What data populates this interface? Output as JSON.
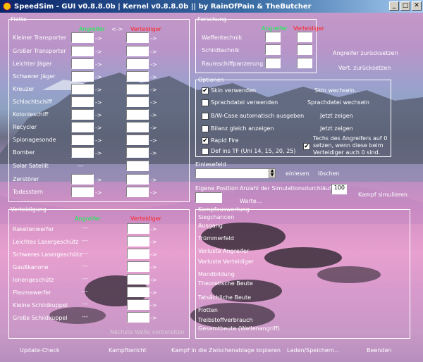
{
  "window": {
    "title": "SpeedSim - GUI v0.8.8.0b | Kernel v0.8.8.0b  ||  by RainOfPain & TheButcher",
    "minimize": "_",
    "maximize": "□",
    "close": "✕"
  },
  "fleet": {
    "title": "Flotte",
    "swap": "<->",
    "attacker_header": "Angreifer",
    "defender_header": "Verteidiger",
    "ships": [
      "Kleiner Transporter",
      "Großer Transporter",
      "Leichter Jäger",
      "Schwerer Jäger",
      "Kreuzer",
      "Schlachtschiff",
      "Kolonieschiff",
      "Recycler",
      "Spionagesonde",
      "Bomber",
      "Solar Satellit",
      "Zerstörer",
      "Todesstern"
    ],
    "arrow": "->",
    "solar_dash": "---"
  },
  "research": {
    "title": "Forschung",
    "attacker_header": "Angreifer",
    "defender_header": "Verteidiger",
    "rows": [
      "Waffentechnik",
      "Schildtechnik",
      "Raumschiffpanzerung"
    ],
    "reset_attacker": "Angreifer zurücksetzen",
    "reset_defender": "Vert. zurücksetzen"
  },
  "options": {
    "title": "Optionen",
    "skin_use": "Skin verwenden",
    "skin_use_checked": "✔",
    "lang_use": "Sprachdatei verwenden",
    "bbcode": "B/W-Case automatisch ausgeben",
    "bilanz": "Bilanz gleich anzeigen",
    "rapid_fire": "Rapid Fire",
    "rapid_fire_checked": "✔",
    "def_tf": "Def ins TF (Uni 14, 15, 20, 25)",
    "skin_change": "Skin wechseln...",
    "lang_change": "Sprachdatei wechseln",
    "show_now_1": "Jetzt zeigen",
    "show_now_2": "Jetzt zeigen",
    "techs_checked": "✔",
    "techs_text_1": "Techs des Angreifers auf 0",
    "techs_text_2": "setzen, wenn diese beim",
    "techs_text_3": "Verteidiger auch 0 sind."
  },
  "readin": {
    "title": "Einlesefeld",
    "read": "einlesen",
    "clear": "löschen"
  },
  "position": {
    "title": "Eigene Position",
    "wait": "Warte..."
  },
  "simulation": {
    "count_label": "Anzahl der Simulationsdurchläufe",
    "count_value": "100",
    "run": "Kampf simulieren"
  },
  "defense": {
    "title": "Verteidigung",
    "attacker_header": "Angreifer",
    "defender_header": "Verteidiger",
    "items": [
      "Raketenwerfer",
      "Leichtes Lasergeschütz",
      "Schweres Lasergeschütz",
      "Gaußkanone",
      "Ionengeschütz",
      "Plasmawerfer",
      "Kleine Schildkuppel",
      "Große Schildkuppel"
    ],
    "dash": "---",
    "next_wave": "Nächste Welle vorbereiten"
  },
  "results": {
    "title": "Kampfauswertung",
    "rows": [
      "Siegchancen",
      "Ausgang",
      "Trümmerfeld",
      "Verluste Angreifer",
      "Verluste Verteidiger",
      "Mondbildung",
      "Theoretische Beute",
      "Tatsächliche Beute",
      "Flotten",
      "Treibstoffverbrauch",
      "Gesamtbeute (Wellenangriff)"
    ]
  },
  "footer": {
    "update": "Update-Check",
    "report": "Kampfbericht",
    "clipboard": "Kampf in die Zwischenablage kopieren",
    "load_save": "Laden/Speichern...",
    "quit": "Beenden"
  },
  "colors": {
    "attacker": "#00ff40",
    "defender": "#ff2020"
  }
}
